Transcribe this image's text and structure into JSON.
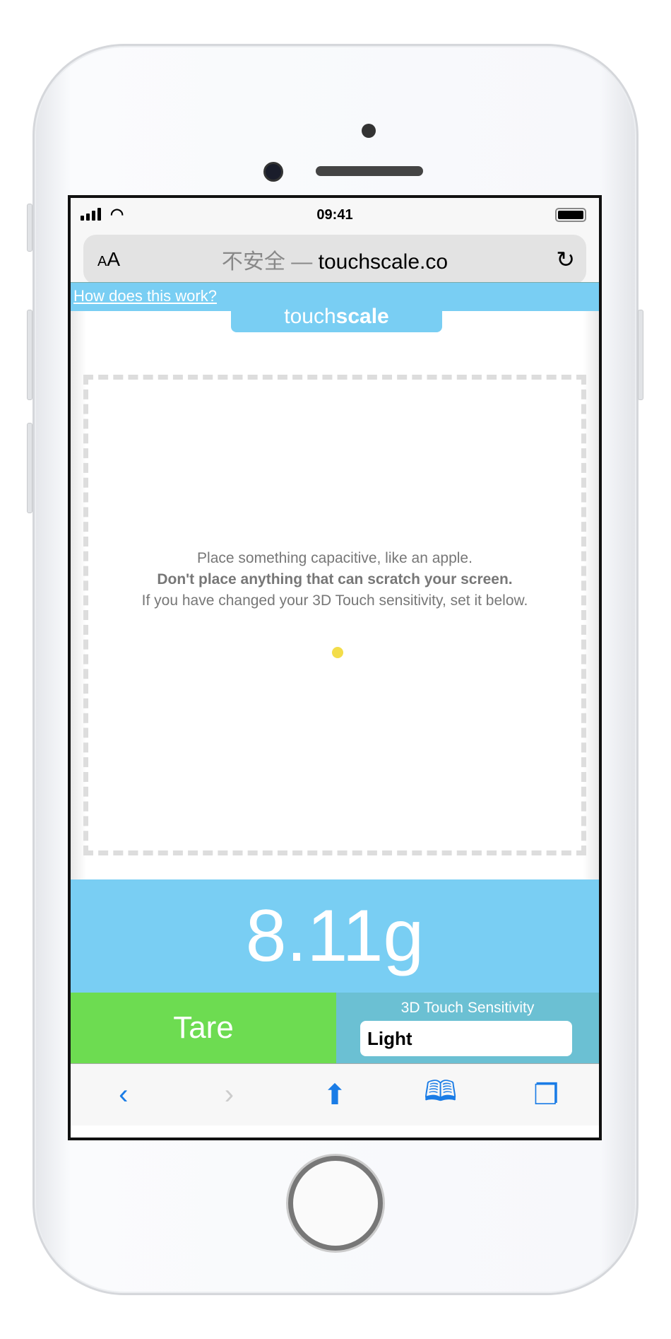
{
  "status": {
    "time": "09:41"
  },
  "browser": {
    "text_size": "AA",
    "insecure_label": "不安全 —",
    "domain": "touchscale.co",
    "back_icon": "chevron-left-icon",
    "forward_icon": "chevron-right-icon",
    "share_icon": "share-icon",
    "bookmarks_icon": "book-icon",
    "tabs_icon": "tabs-icon"
  },
  "site": {
    "help_link": "How does this work?",
    "logo_light": "touch",
    "logo_bold": "scale",
    "instructions": [
      "Place something capacitive, like an apple.",
      "Don't place anything that can scratch your screen.",
      "If you have changed your 3D Touch sensitivity, set it below."
    ],
    "weight": "8.11g",
    "tare_label": "Tare",
    "sensitivity_label": "3D Touch Sensitivity",
    "sensitivity_value": "Light"
  },
  "colors": {
    "accent": "#79cef3",
    "tare": "#6ddc51",
    "sensitivity_bg": "#6bc0d3",
    "touch_dot": "#f3dd4a"
  }
}
